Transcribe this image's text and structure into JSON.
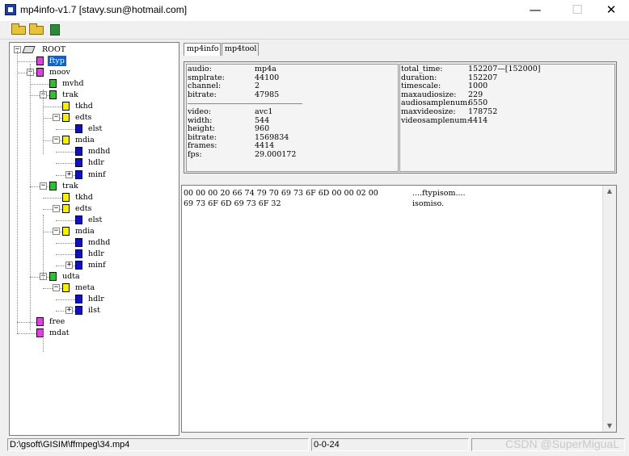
{
  "window": {
    "title": "mp4info-v1.7 [stavy.sun@hotmail.com]",
    "minimize": "—",
    "maximize": "☐",
    "close": "✕"
  },
  "toolbar": {
    "open_icon": "open-folder-icon",
    "open2_icon": "open-folder-icon",
    "exit_icon": "exit-icon"
  },
  "tree": {
    "root_label": "ROOT",
    "nodes": [
      {
        "label": "ftyp",
        "color": "#e040e0"
      },
      {
        "label": "moov",
        "color": "#e040e0"
      },
      {
        "label": "mvhd",
        "color": "#2fbf2f"
      },
      {
        "label": "trak",
        "color": "#2fbf2f"
      },
      {
        "label": "tkhd",
        "color": "#f7f000"
      },
      {
        "label": "edts",
        "color": "#f7f000"
      },
      {
        "label": "elst",
        "color": "#1010c8"
      },
      {
        "label": "mdia",
        "color": "#f7f000"
      },
      {
        "label": "mdhd",
        "color": "#1010c8"
      },
      {
        "label": "hdlr",
        "color": "#1010c8"
      },
      {
        "label": "minf",
        "color": "#1010c8"
      },
      {
        "label": "trak",
        "color": "#2fbf2f"
      },
      {
        "label": "tkhd",
        "color": "#f7f000"
      },
      {
        "label": "edts",
        "color": "#f7f000"
      },
      {
        "label": "elst",
        "color": "#1010c8"
      },
      {
        "label": "mdia",
        "color": "#f7f000"
      },
      {
        "label": "mdhd",
        "color": "#1010c8"
      },
      {
        "label": "hdlr",
        "color": "#1010c8"
      },
      {
        "label": "minf",
        "color": "#1010c8"
      },
      {
        "label": "udta",
        "color": "#2fbf2f"
      },
      {
        "label": "meta",
        "color": "#f7f000"
      },
      {
        "label": "hdlr",
        "color": "#1010c8"
      },
      {
        "label": "ilst",
        "color": "#1010c8"
      },
      {
        "label": "free",
        "color": "#e040e0"
      },
      {
        "label": "mdat",
        "color": "#e040e0"
      }
    ]
  },
  "tabs": [
    {
      "label": "mp4info"
    },
    {
      "label": "mp4tool"
    }
  ],
  "audio_info": [
    {
      "key": "audio:",
      "value": "mp4a"
    },
    {
      "key": "smplrate:",
      "value": "44100"
    },
    {
      "key": "channel:",
      "value": "2"
    },
    {
      "key": "bitrate:",
      "value": "47985"
    }
  ],
  "video_info": [
    {
      "key": "video:",
      "value": "avc1"
    },
    {
      "key": "width:",
      "value": "544"
    },
    {
      "key": "height:",
      "value": "960"
    },
    {
      "key": "bitrate:",
      "value": "1569834"
    },
    {
      "key": "frames:",
      "value": "4414"
    },
    {
      "key": "fps:",
      "value": "29.000172"
    }
  ],
  "time_info": [
    {
      "key": "total_time:",
      "value": "152207—[152000]"
    },
    {
      "key": "duration:",
      "value": "152207"
    },
    {
      "key": "timescale:",
      "value": "1000"
    },
    {
      "key": "maxaudiosize:",
      "value": "229"
    },
    {
      "key": "audiosamplenum:",
      "value": "6550"
    },
    {
      "key": "maxvideosize:",
      "value": "178752"
    },
    {
      "key": "videosamplenum:",
      "value": "4414"
    }
  ],
  "hex": {
    "lines": [
      {
        "bytes": "00 00 00 20 66 74 79 70   69 73 6F 6D 00 00 02 00",
        "ascii": "....ftypisom...."
      },
      {
        "bytes": "69 73 6F 6D 69 73 6F 32",
        "ascii": "isomiso."
      }
    ]
  },
  "status": {
    "path": "D:\\gsoft\\GISIM\\ffmpeg\\34.mp4",
    "position": "0-0-24",
    "extra": ""
  },
  "watermark": "CSDN @SuperMiguaL"
}
